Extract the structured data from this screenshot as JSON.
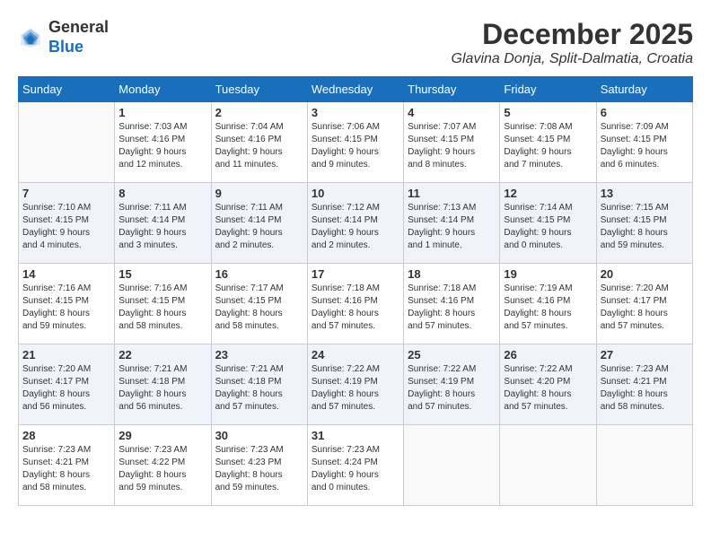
{
  "header": {
    "logo_line1": "General",
    "logo_line2": "Blue",
    "month_year": "December 2025",
    "location": "Glavina Donja, Split-Dalmatia, Croatia"
  },
  "days_of_week": [
    "Sunday",
    "Monday",
    "Tuesday",
    "Wednesday",
    "Thursday",
    "Friday",
    "Saturday"
  ],
  "weeks": [
    [
      {
        "day": "",
        "info": ""
      },
      {
        "day": "1",
        "info": "Sunrise: 7:03 AM\nSunset: 4:16 PM\nDaylight: 9 hours\nand 12 minutes."
      },
      {
        "day": "2",
        "info": "Sunrise: 7:04 AM\nSunset: 4:16 PM\nDaylight: 9 hours\nand 11 minutes."
      },
      {
        "day": "3",
        "info": "Sunrise: 7:06 AM\nSunset: 4:15 PM\nDaylight: 9 hours\nand 9 minutes."
      },
      {
        "day": "4",
        "info": "Sunrise: 7:07 AM\nSunset: 4:15 PM\nDaylight: 9 hours\nand 8 minutes."
      },
      {
        "day": "5",
        "info": "Sunrise: 7:08 AM\nSunset: 4:15 PM\nDaylight: 9 hours\nand 7 minutes."
      },
      {
        "day": "6",
        "info": "Sunrise: 7:09 AM\nSunset: 4:15 PM\nDaylight: 9 hours\nand 6 minutes."
      }
    ],
    [
      {
        "day": "7",
        "info": "Sunrise: 7:10 AM\nSunset: 4:15 PM\nDaylight: 9 hours\nand 4 minutes."
      },
      {
        "day": "8",
        "info": "Sunrise: 7:11 AM\nSunset: 4:14 PM\nDaylight: 9 hours\nand 3 minutes."
      },
      {
        "day": "9",
        "info": "Sunrise: 7:11 AM\nSunset: 4:14 PM\nDaylight: 9 hours\nand 2 minutes."
      },
      {
        "day": "10",
        "info": "Sunrise: 7:12 AM\nSunset: 4:14 PM\nDaylight: 9 hours\nand 2 minutes."
      },
      {
        "day": "11",
        "info": "Sunrise: 7:13 AM\nSunset: 4:14 PM\nDaylight: 9 hours\nand 1 minute."
      },
      {
        "day": "12",
        "info": "Sunrise: 7:14 AM\nSunset: 4:15 PM\nDaylight: 9 hours\nand 0 minutes."
      },
      {
        "day": "13",
        "info": "Sunrise: 7:15 AM\nSunset: 4:15 PM\nDaylight: 8 hours\nand 59 minutes."
      }
    ],
    [
      {
        "day": "14",
        "info": "Sunrise: 7:16 AM\nSunset: 4:15 PM\nDaylight: 8 hours\nand 59 minutes."
      },
      {
        "day": "15",
        "info": "Sunrise: 7:16 AM\nSunset: 4:15 PM\nDaylight: 8 hours\nand 58 minutes."
      },
      {
        "day": "16",
        "info": "Sunrise: 7:17 AM\nSunset: 4:15 PM\nDaylight: 8 hours\nand 58 minutes."
      },
      {
        "day": "17",
        "info": "Sunrise: 7:18 AM\nSunset: 4:16 PM\nDaylight: 8 hours\nand 57 minutes."
      },
      {
        "day": "18",
        "info": "Sunrise: 7:18 AM\nSunset: 4:16 PM\nDaylight: 8 hours\nand 57 minutes."
      },
      {
        "day": "19",
        "info": "Sunrise: 7:19 AM\nSunset: 4:16 PM\nDaylight: 8 hours\nand 57 minutes."
      },
      {
        "day": "20",
        "info": "Sunrise: 7:20 AM\nSunset: 4:17 PM\nDaylight: 8 hours\nand 57 minutes."
      }
    ],
    [
      {
        "day": "21",
        "info": "Sunrise: 7:20 AM\nSunset: 4:17 PM\nDaylight: 8 hours\nand 56 minutes."
      },
      {
        "day": "22",
        "info": "Sunrise: 7:21 AM\nSunset: 4:18 PM\nDaylight: 8 hours\nand 56 minutes."
      },
      {
        "day": "23",
        "info": "Sunrise: 7:21 AM\nSunset: 4:18 PM\nDaylight: 8 hours\nand 57 minutes."
      },
      {
        "day": "24",
        "info": "Sunrise: 7:22 AM\nSunset: 4:19 PM\nDaylight: 8 hours\nand 57 minutes."
      },
      {
        "day": "25",
        "info": "Sunrise: 7:22 AM\nSunset: 4:19 PM\nDaylight: 8 hours\nand 57 minutes."
      },
      {
        "day": "26",
        "info": "Sunrise: 7:22 AM\nSunset: 4:20 PM\nDaylight: 8 hours\nand 57 minutes."
      },
      {
        "day": "27",
        "info": "Sunrise: 7:23 AM\nSunset: 4:21 PM\nDaylight: 8 hours\nand 58 minutes."
      }
    ],
    [
      {
        "day": "28",
        "info": "Sunrise: 7:23 AM\nSunset: 4:21 PM\nDaylight: 8 hours\nand 58 minutes."
      },
      {
        "day": "29",
        "info": "Sunrise: 7:23 AM\nSunset: 4:22 PM\nDaylight: 8 hours\nand 59 minutes."
      },
      {
        "day": "30",
        "info": "Sunrise: 7:23 AM\nSunset: 4:23 PM\nDaylight: 8 hours\nand 59 minutes."
      },
      {
        "day": "31",
        "info": "Sunrise: 7:23 AM\nSunset: 4:24 PM\nDaylight: 9 hours\nand 0 minutes."
      },
      {
        "day": "",
        "info": ""
      },
      {
        "day": "",
        "info": ""
      },
      {
        "day": "",
        "info": ""
      }
    ]
  ]
}
